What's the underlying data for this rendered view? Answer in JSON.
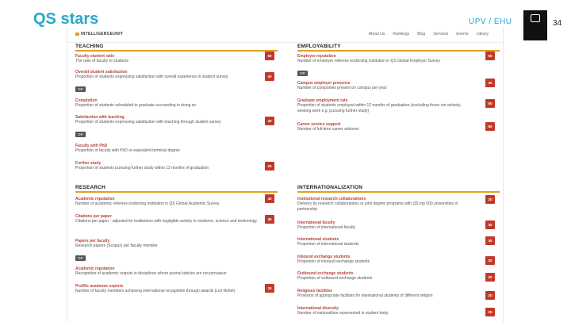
{
  "slide": {
    "title": "QS stars",
    "subtitle": "UPV / EHU",
    "page_number": "34",
    "logo": {
      "line1": "",
      "line2": ""
    }
  },
  "site": {
    "brand": "INTELLIGENCEUNIT",
    "nav": [
      "About Us",
      "Rankings",
      "Blog",
      "Services",
      "Events",
      "Library"
    ]
  },
  "teaching": {
    "heading": "TEACHING",
    "metrics": [
      {
        "name": "Faculty student ratio",
        "desc": "The ratio of faculty to students",
        "score": "50",
        "or": ""
      },
      {
        "name": "Overall student satisfaction",
        "desc": "Proportion of students expressing satisfaction with overall experience in student survey",
        "score": "40",
        "or": "OR"
      },
      {
        "name": "Completion",
        "desc": "Proportion of students scheduled to graduate succeeding in doing so",
        "score": "",
        "or": ""
      },
      {
        "name": "Satisfaction with teaching",
        "desc": "Proportion of students expressing satisfaction with teaching through student survey",
        "score": "40",
        "or": "OR"
      },
      {
        "name": "Faculty with PhD",
        "desc": "Proportion of faculty with PhD or equivalent terminal degree",
        "score": "",
        "or": ""
      },
      {
        "name": "Further study",
        "desc": "Proportion of students pursuing further study within 12 months of graduation",
        "score": "20",
        "or": ""
      }
    ]
  },
  "employability": {
    "heading": "EMPLOYABILITY",
    "metrics": [
      {
        "name": "Employer reputation",
        "desc": "Number of employer referees endorsing institution in QS Global Employer Survey",
        "score": "50",
        "or": "OR"
      },
      {
        "name": "Campus employer presence",
        "desc": "Number of companies present on campus per year",
        "score": "30",
        "or": ""
      },
      {
        "name": "Graduate employment rate",
        "desc": "Proportion of students employed within 12 months of graduation (excluding those not actively seeking work e.g. pursuing further study)",
        "score": "50",
        "or": ""
      },
      {
        "name": "Career service support",
        "desc": "Number of full-time career advisors",
        "score": "50",
        "or": ""
      }
    ]
  },
  "research": {
    "heading": "RESEARCH",
    "metrics": [
      {
        "name": "Academic reputation",
        "desc": "Number of academic referees endorsing institution in QS Global Academic Survey",
        "score": "40",
        "or": ""
      },
      {
        "name": "Citations per paper",
        "desc": "Citations per paper - adjusted for institutions with negligible activity in medicine, science and technology",
        "score": "40",
        "or": ""
      },
      {
        "name": "Papers per faculty",
        "desc": "Research papers (Scopus) per faculty member",
        "score": "",
        "or": "OR"
      },
      {
        "name": "Academic reputation",
        "desc": "Recognition of academic outputs in disciplines where journal articles are not pervasive",
        "score": "",
        "or": ""
      },
      {
        "name": "Prolific academic experts",
        "desc": "Number of faculty members achieving international recognition through awards (List Nobel)",
        "score": "30",
        "or": ""
      }
    ]
  },
  "internationalization": {
    "heading": "INTERNATIONALIZATION",
    "metrics": [
      {
        "name": "Institutional research collaborations",
        "desc": "Delivery by research collaborations or joint degree programs with QS top 500 universities in partnership",
        "score": "20",
        "or": ""
      },
      {
        "name": "International faculty",
        "desc": "Proportion of international faculty",
        "score": "30",
        "or": ""
      },
      {
        "name": "International students",
        "desc": "Proportion of international students",
        "score": "30",
        "or": ""
      },
      {
        "name": "Inbound exchange students",
        "desc": "Proportion of inbound exchange students",
        "score": "20",
        "or": ""
      },
      {
        "name": "Outbound exchange students",
        "desc": "Proportion of outbound exchange students",
        "score": "20",
        "or": ""
      },
      {
        "name": "Religious facilities",
        "desc": "Provision of appropriate facilities for international students of different religion",
        "score": "20",
        "or": ""
      },
      {
        "name": "International diversity",
        "desc": "Number of nationalities represented in student body",
        "score": "20",
        "or": ""
      }
    ]
  },
  "colors": {
    "accent": "#2aa7c9",
    "rule": "#e0a21b",
    "score": "#c0392b",
    "metric_name": "#b5433a"
  }
}
